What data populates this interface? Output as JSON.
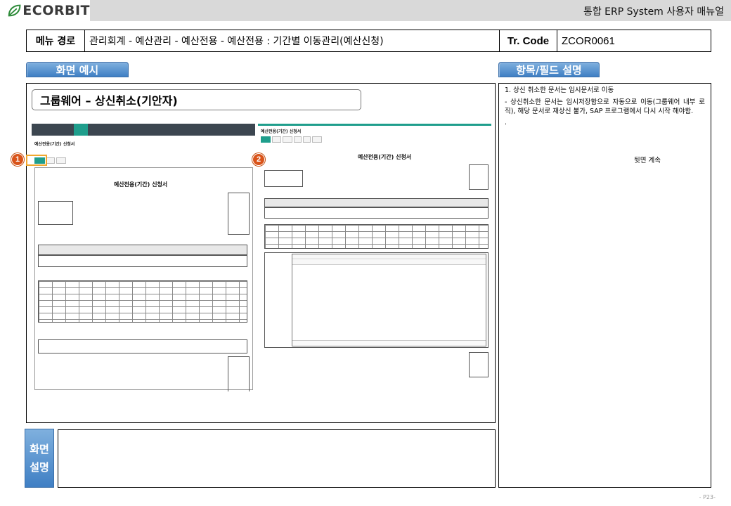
{
  "header": {
    "logo_text": "ECORBIT",
    "manual_title": "통합 ERP System 사용자 매뉴얼"
  },
  "menu": {
    "path_label": "메뉴 경로",
    "path_value": "관리회계 - 예산관리 - 예산전용 - 예산전용 : 기간별 이동관리(예산신청)",
    "trcode_label": "Tr. Code",
    "trcode_value": "ZCOR0061"
  },
  "tabs": {
    "screen_example": "화면 예시",
    "field_desc": "항목/필드 설명"
  },
  "screen": {
    "caption": "그룹웨어 – 상신취소(기안자)",
    "badge1": "1",
    "badge2": "2",
    "left_mock": {
      "title": "예산전용(기간) 신청서",
      "doc_title": "예산전용(기간) 신청서"
    },
    "right_mock": {
      "title": "예산전용(기간) 신청서",
      "doc_title": "예산전용(기간) 신청서"
    }
  },
  "fields": {
    "item1": "1. 상신 취소한 문서는 임시문서로 이동",
    "item1_detail": " - 상신취소한 문서는 임시저장함으로 자동으로 이동(그룹웨어 내부 로직), 해당 문서로 재상신 불가, SAP 프로그램에서 다시 시작 해야함.",
    "dot": ".",
    "continued": "뒷면 계속"
  },
  "explanation": {
    "label_line1": "화면",
    "label_line2": "설명",
    "text": ""
  },
  "page": {
    "number": "- P23-"
  },
  "colors": {
    "tab_blue": "#4f8ed0",
    "header_gray": "#d9d9d9",
    "badge_orange": "#d9541a",
    "highlight_orange": "#f0a830",
    "mock_accent_teal": "#1f9e8c"
  }
}
